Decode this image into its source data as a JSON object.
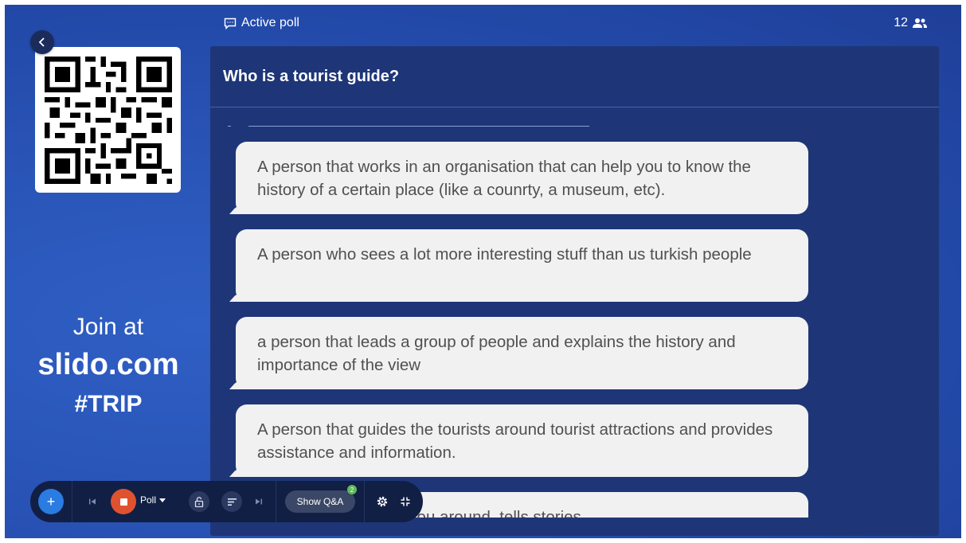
{
  "header": {
    "active_label": "Active poll",
    "participants_count": "12"
  },
  "question": {
    "title": "Who is a tourist guide?"
  },
  "answers": [
    "A person that works in an organisation that can help you to know the history of a certain place (like a counrty, a museum, etc).",
    "A person who sees a lot more interesting stuff than us turkish people",
    "a person that leads a group of people and explains the history and importance of the view",
    "A person that guides the tourists around tourist attractions and provides assistance and information.",
    "A person that shows you around, tells stories"
  ],
  "join": {
    "line1": "Join at",
    "url": "slido.com",
    "code": "#TRIP"
  },
  "toolbar": {
    "add_label": "+",
    "poll_label": "Poll",
    "show_qa_label": "Show Q&A",
    "qa_badge": "2"
  },
  "icons": {
    "back": "chevron-left-icon",
    "header": "chat-bubble-icon",
    "participants": "people-icon",
    "toolbar": [
      "plus-icon",
      "skip-previous-icon",
      "stop-icon",
      "chevron-down-icon",
      "unlock-icon",
      "list-icon",
      "skip-next-icon",
      "settings-icon",
      "collapse-icon"
    ]
  },
  "colors": {
    "background": "#2a55b8",
    "panel": "#1e3678",
    "bubble": "#f1f1f1",
    "stop": "#e0522f",
    "accent": "#2a7be2",
    "badge": "#5fb85a"
  }
}
